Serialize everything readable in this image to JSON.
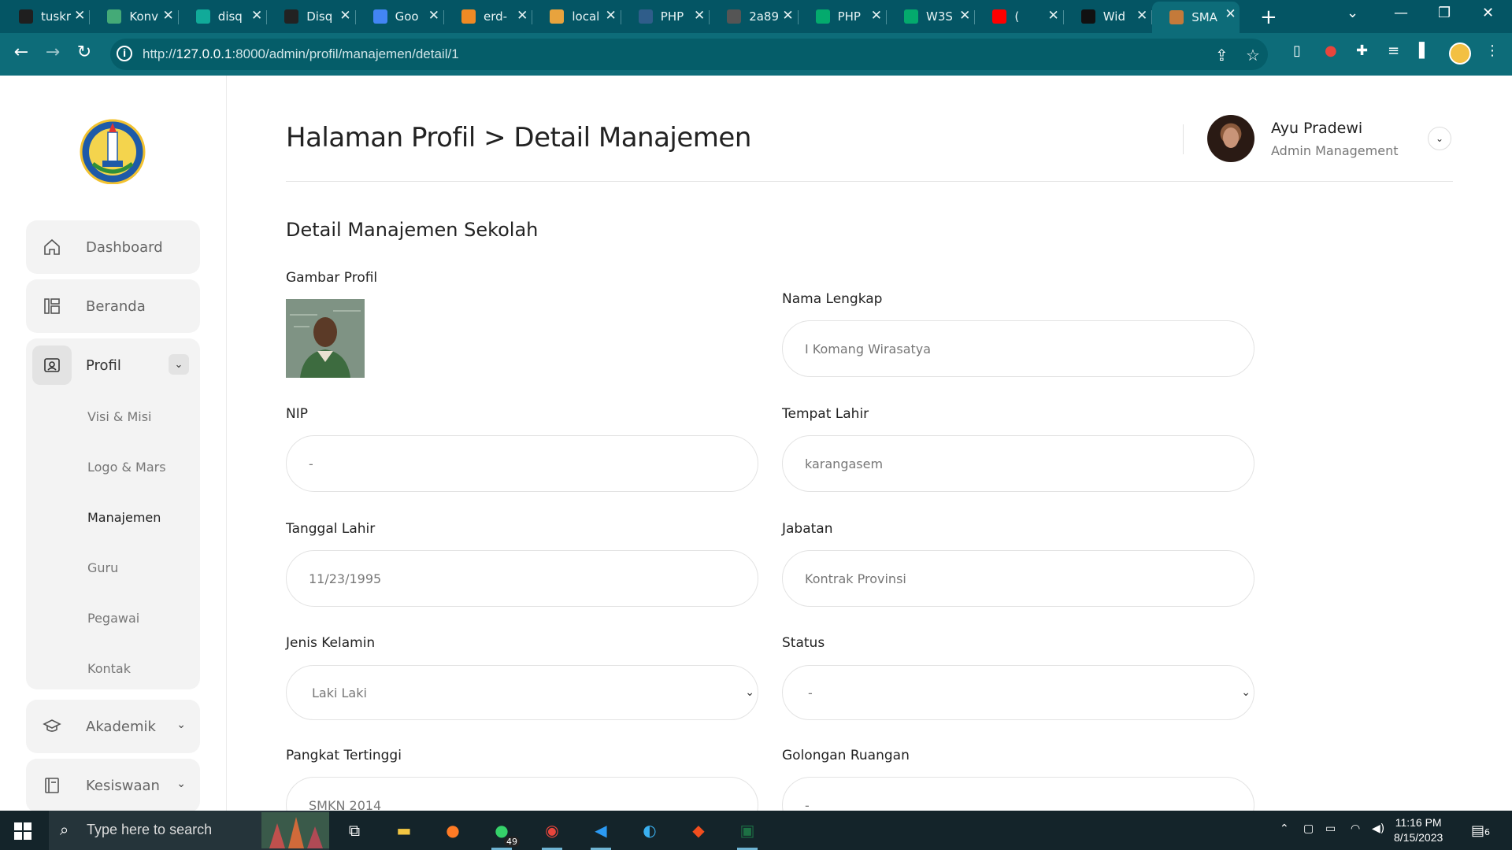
{
  "browser": {
    "tabs": [
      {
        "title": "tuskr",
        "color": "#1f1f1f"
      },
      {
        "title": "Konv",
        "color": "#4a7"
      },
      {
        "title": "disq",
        "color": "#1a9"
      },
      {
        "title": "Disq",
        "color": "#222"
      },
      {
        "title": "Goo",
        "color": "#4285f4"
      },
      {
        "title": "erd-",
        "color": "#f08a24"
      },
      {
        "title": "local",
        "color": "#e8a33d"
      },
      {
        "title": "PHP",
        "color": "#2f5d8a"
      },
      {
        "title": "2a89",
        "color": "#555"
      },
      {
        "title": "PHP",
        "color": "#04aa6d"
      },
      {
        "title": "W3S",
        "color": "#04aa6d"
      },
      {
        "title": "(",
        "color": "#ff0000"
      },
      {
        "title": "Wid",
        "color": "#111"
      },
      {
        "title": "SMA",
        "color": "#c47a3a"
      }
    ],
    "url_prefix": "http://",
    "url_host": "127.0.0.1",
    "url_rest": ":8000/admin/profil/manajemen/detail/1"
  },
  "sidebar": {
    "items": [
      {
        "label": "Dashboard",
        "icon": "home-icon"
      },
      {
        "label": "Beranda",
        "icon": "layout-icon"
      },
      {
        "label": "Profil",
        "icon": "profile-card-icon"
      },
      {
        "label": "Akademik",
        "icon": "graduation-cap-icon"
      },
      {
        "label": "Kesiswaan",
        "icon": "book-icon"
      }
    ],
    "submenu": [
      "Visi & Misi",
      "Logo & Mars",
      "Manajemen",
      "Guru",
      "Pegawai",
      "Kontak"
    ],
    "active_submenu": "Manajemen"
  },
  "header": {
    "title": "Halaman Profil > Detail Manajemen",
    "user_name": "Ayu Pradewi",
    "user_role": "Admin Management"
  },
  "main": {
    "section_title": "Detail Manajemen Sekolah",
    "fields": {
      "gambar_profil": {
        "label": "Gambar Profil"
      },
      "nama_lengkap": {
        "label": "Nama Lengkap",
        "value": "I Komang Wirasatya"
      },
      "nip": {
        "label": "NIP",
        "value": "-"
      },
      "tempat_lahir": {
        "label": "Tempat Lahir",
        "value": "karangasem"
      },
      "tanggal_lahir": {
        "label": "Tanggal Lahir",
        "value": "11/23/1995"
      },
      "jabatan": {
        "label": "Jabatan",
        "value": "Kontrak Provinsi"
      },
      "jenis_kelamin": {
        "label": "Jenis Kelamin",
        "value": "Laki Laki"
      },
      "status": {
        "label": "Status",
        "value": "-"
      },
      "pangkat_tertinggi": {
        "label": "Pangkat Tertinggi",
        "value": "SMKN 2014"
      },
      "golongan_ruangan": {
        "label": "Golongan Ruangan",
        "value": "-"
      }
    }
  },
  "taskbar": {
    "search_placeholder": "Type here to search",
    "whatsapp_badge": "49",
    "time": "11:16 PM",
    "date": "8/15/2023",
    "notifications": "6"
  }
}
